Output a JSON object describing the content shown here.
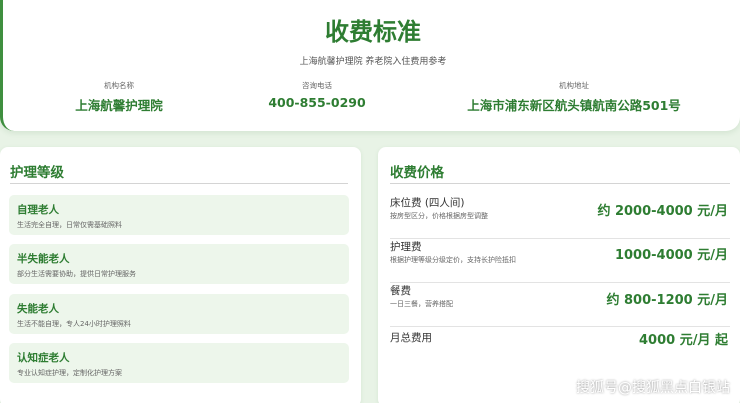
{
  "header": {
    "title": "收费标准",
    "subtitle": "上海航馨护理院 养老院入住费用参考",
    "info": [
      {
        "label": "机构名称",
        "value": "上海航馨护理院"
      },
      {
        "label": "咨询电话",
        "value": "400-855-0290"
      },
      {
        "label": "机构地址",
        "value": "上海市浦东新区航头镇航南公路501号"
      }
    ]
  },
  "care_levels": {
    "title": "护理等级",
    "items": [
      {
        "name": "自理老人",
        "desc": "生活完全自理，日常仅需基础照料"
      },
      {
        "name": "半失能老人",
        "desc": "部分生活需要协助，提供日常护理服务"
      },
      {
        "name": "失能老人",
        "desc": "生活不能自理，专人24小时护理照料"
      },
      {
        "name": "认知症老人",
        "desc": "专业认知症护理，定制化护理方案"
      }
    ]
  },
  "prices": {
    "title": "收费价格",
    "items": [
      {
        "name": "床位费 (四人间)",
        "desc": "按房型区分，价格根据房型调整",
        "value": "约 2000-4000 元/月"
      },
      {
        "name": "护理费",
        "desc": "根据护理等级分级定价，支持长护险抵扣",
        "value": "1000-4000 元/月"
      },
      {
        "name": "餐费",
        "desc": "一日三餐，营养搭配",
        "value": "约 800-1200 元/月"
      },
      {
        "name": "月总费用",
        "desc": "",
        "value": "4000 元/月 起"
      }
    ]
  },
  "watermark": "搜狐号@搜狐黑点白银站",
  "colors": {
    "accent": "#2e7d32",
    "background": "#e8f3e6",
    "card": "#edf6eb"
  }
}
